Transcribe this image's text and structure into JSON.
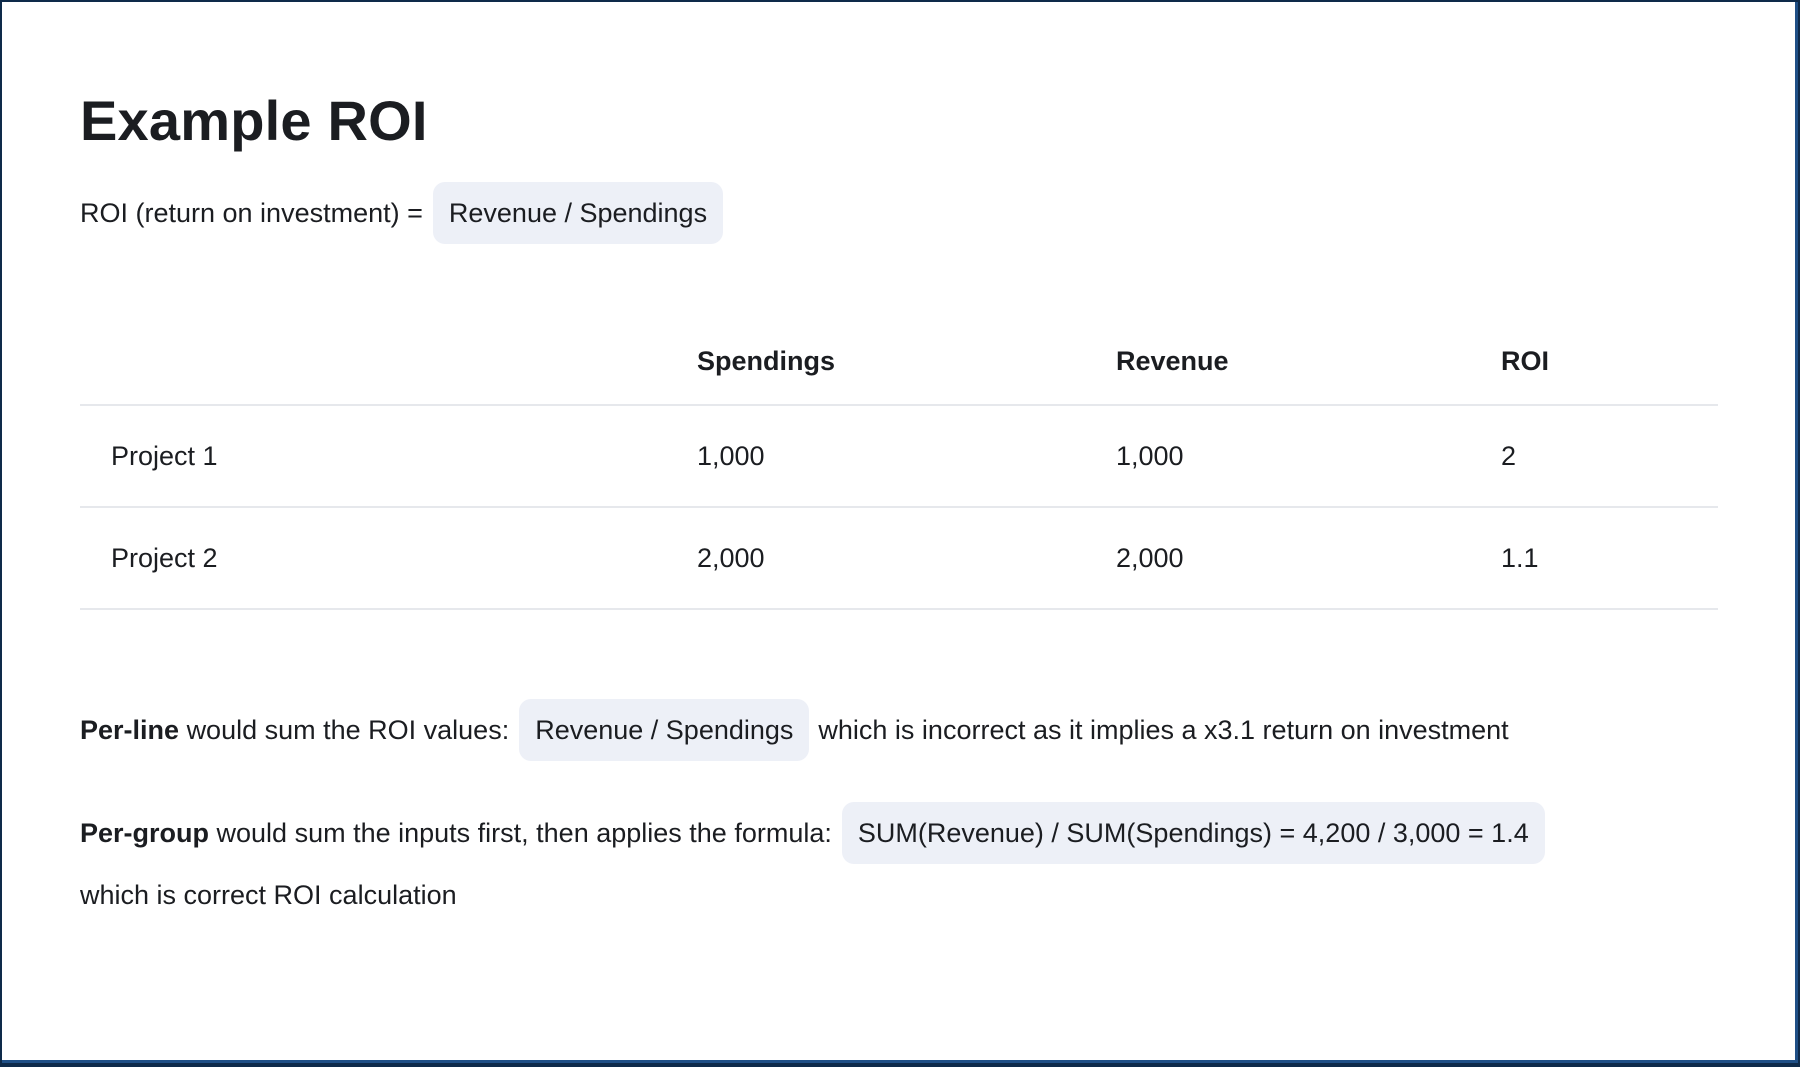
{
  "title": "Example ROI",
  "formula": {
    "prefix": "ROI (return on investment) =",
    "expression": "Revenue / Spendings"
  },
  "table": {
    "headers": [
      "",
      "Spendings",
      "Revenue",
      "ROI"
    ],
    "rows": [
      {
        "name": "Project 1",
        "spendings": "1,000",
        "revenue": "1,000",
        "roi": "2"
      },
      {
        "name": "Project 2",
        "spendings": "2,000",
        "revenue": "2,000",
        "roi": "1.1"
      }
    ]
  },
  "per_line": {
    "label": "Per-line",
    "text": "would sum the ROI values:",
    "expression": "Revenue / Spendings",
    "tail": "which is incorrect as it implies a x3.1 return on investment"
  },
  "per_group": {
    "label": "Per-group",
    "text": "would sum the inputs first, then applies the formula:",
    "expression": "SUM(Revenue) / SUM(Spendings) = 4,200 / 3,000 = 1.4",
    "tail": "which is correct ROI calculation"
  },
  "colors": {
    "chip_background": "#edf0f7",
    "frame_border": "#1f4f86",
    "divider": "#e6e8ec"
  }
}
